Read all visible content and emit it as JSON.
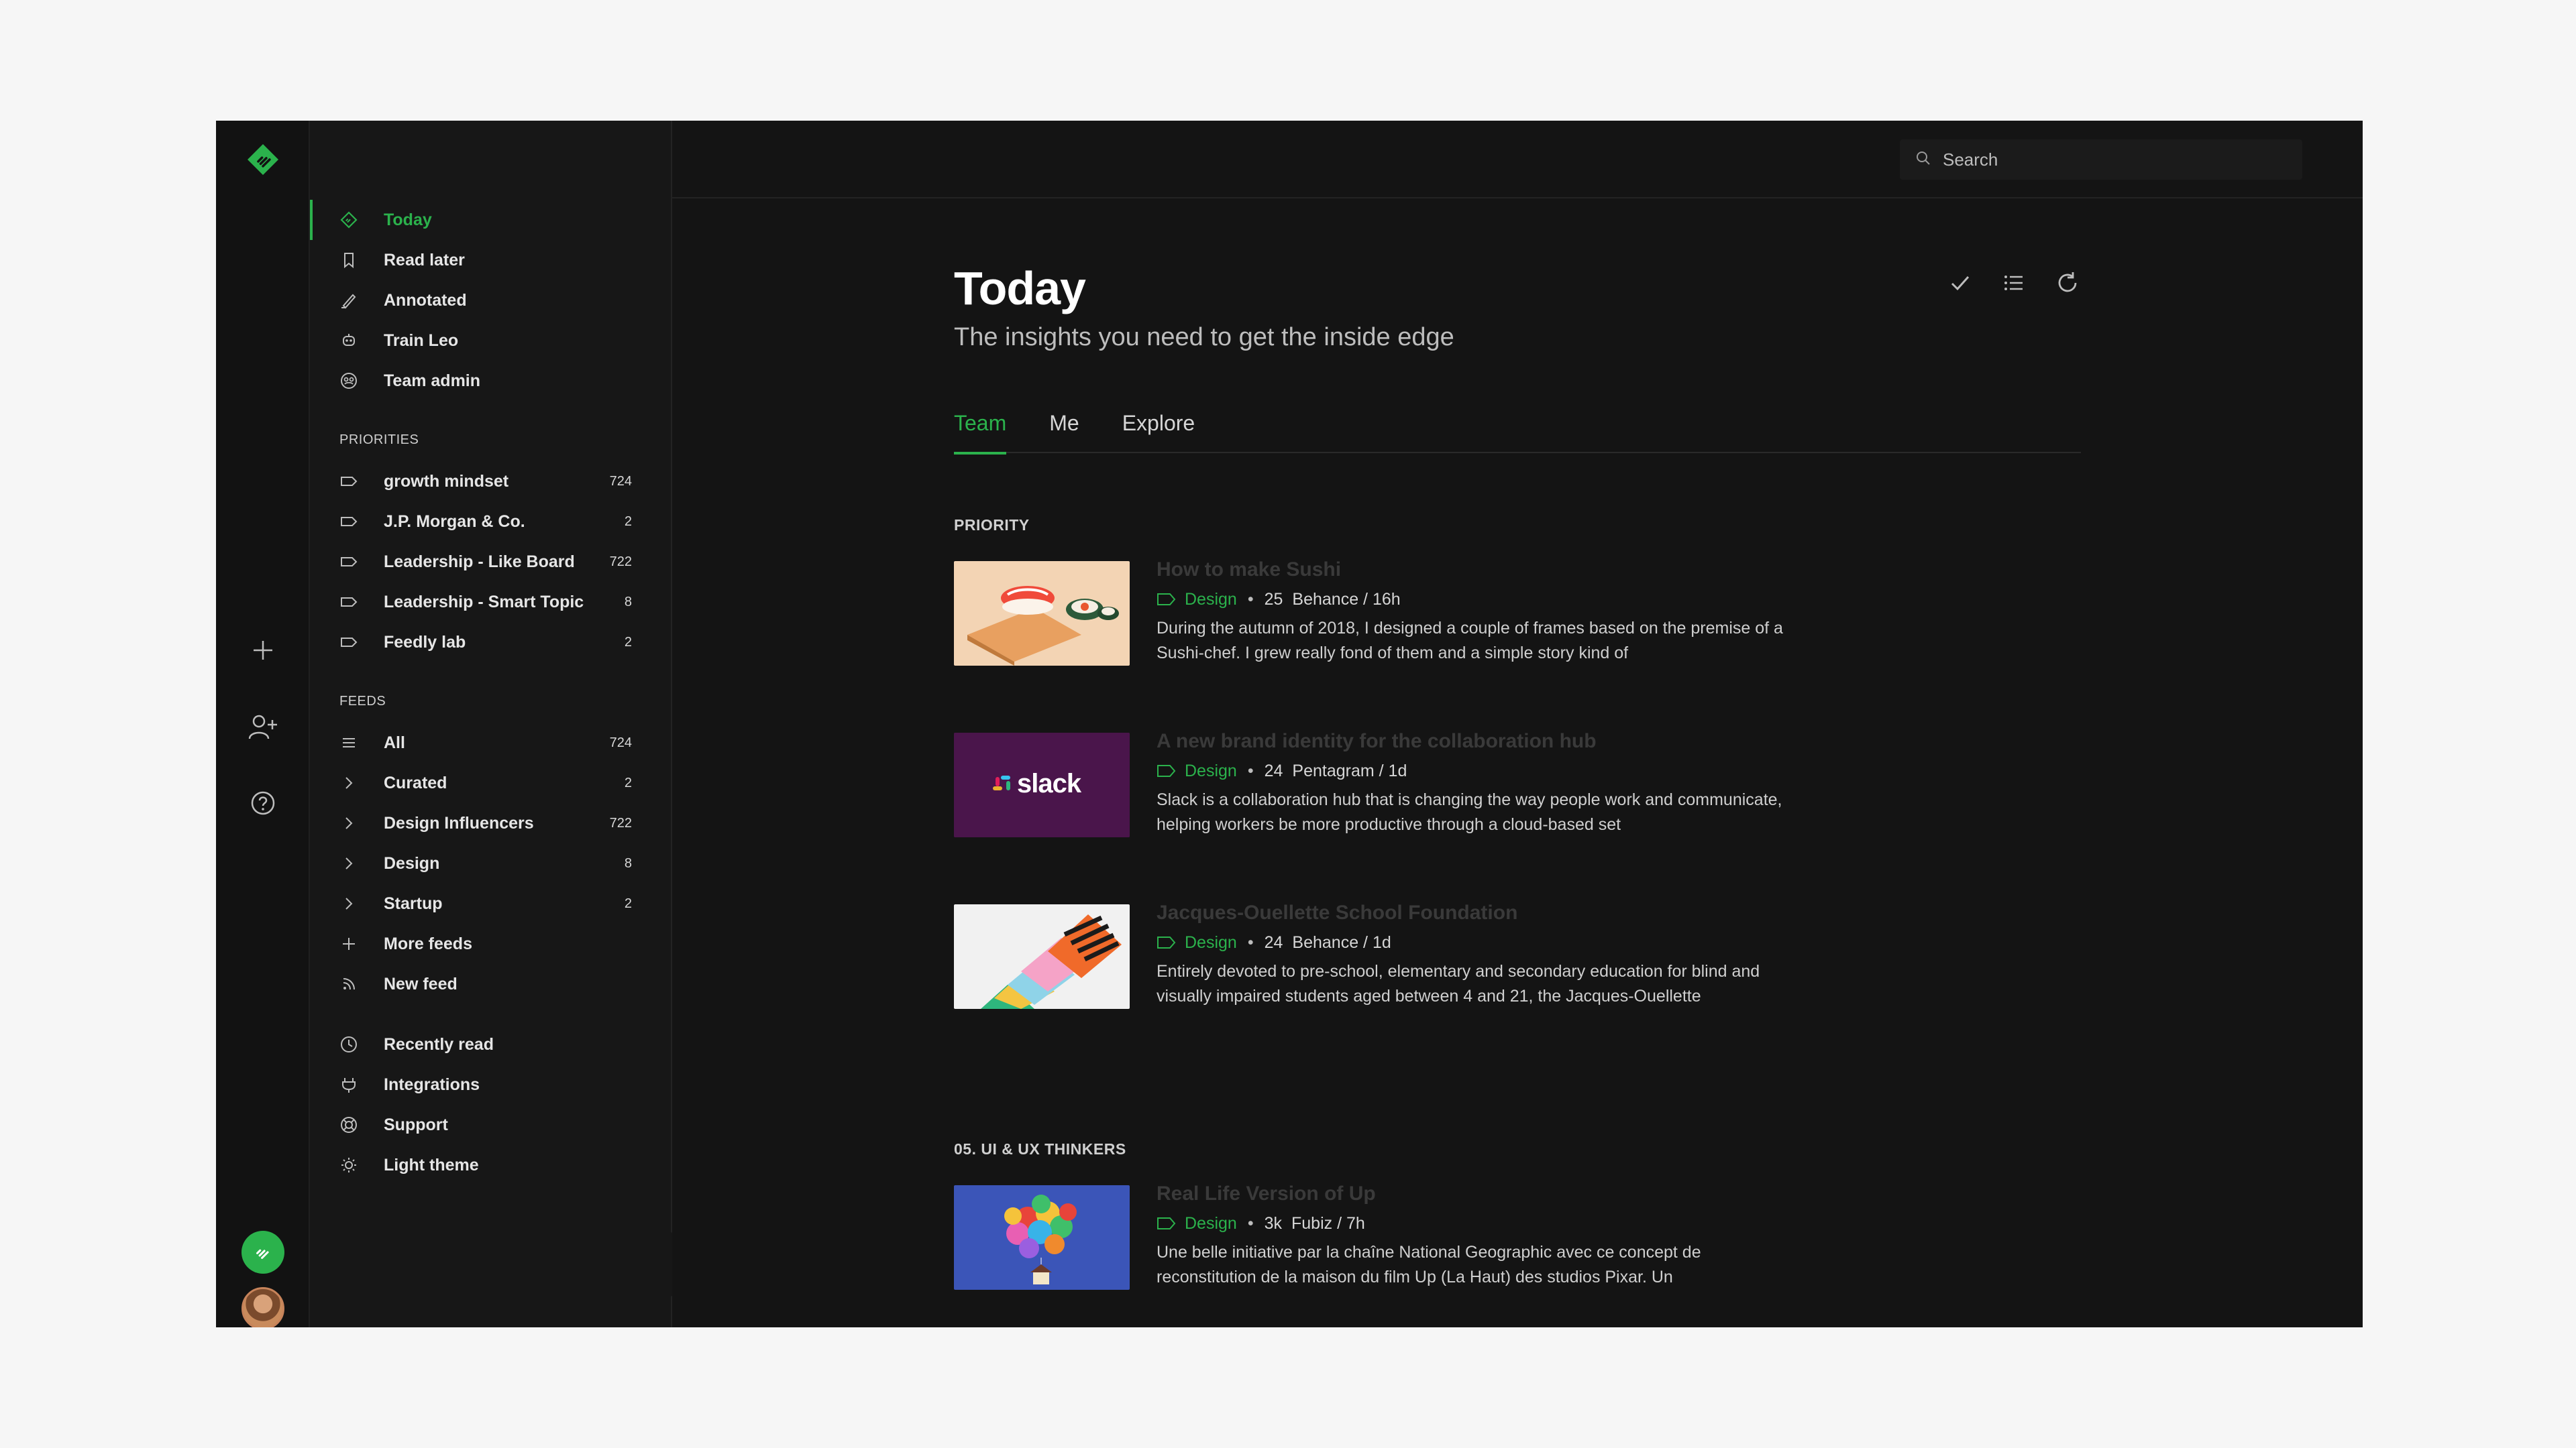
{
  "colors": {
    "accent": "#2bb24c",
    "background": "#141414",
    "sidebar": "#171717"
  },
  "search": {
    "placeholder": "Search"
  },
  "nav": {
    "top": [
      {
        "label": "Today",
        "icon": "feedly-diamond-icon",
        "active": true
      },
      {
        "label": "Read later",
        "icon": "bookmark-icon"
      },
      {
        "label": "Annotated",
        "icon": "pen-icon"
      },
      {
        "label": "Train Leo",
        "icon": "leo-robot-icon"
      },
      {
        "label": "Team admin",
        "icon": "team-icon"
      }
    ],
    "priorities_title": "PRIORITIES",
    "priorities": [
      {
        "label": "growth mindset",
        "count": "724"
      },
      {
        "label": "J.P. Morgan & Co.",
        "count": "2"
      },
      {
        "label": "Leadership - Like Board",
        "count": "722"
      },
      {
        "label": "Leadership - Smart Topic",
        "count": "8"
      },
      {
        "label": "Feedly lab",
        "count": "2"
      }
    ],
    "feeds_title": "FEEDS",
    "feeds": [
      {
        "label": "All",
        "count": "724"
      },
      {
        "label": "Curated",
        "count": "2"
      },
      {
        "label": "Design Influencers",
        "count": "722"
      },
      {
        "label": "Design",
        "count": "8"
      },
      {
        "label": "Startup",
        "count": "2"
      }
    ],
    "more_feeds": "More feeds",
    "new_feed": "New feed",
    "bottom": [
      {
        "label": "Recently read",
        "icon": "clock-icon"
      },
      {
        "label": "Integrations",
        "icon": "plug-icon"
      },
      {
        "label": "Support",
        "icon": "lifebuoy-icon"
      },
      {
        "label": "Light theme",
        "icon": "sun-icon"
      }
    ]
  },
  "main": {
    "title": "Today",
    "subtitle": "The insights you need to get the inside edge",
    "tabs": [
      {
        "label": "Team",
        "active": true
      },
      {
        "label": "Me"
      },
      {
        "label": "Explore"
      }
    ],
    "groups": [
      {
        "title": "PRIORITY",
        "articles": [
          {
            "title": "How to make Sushi",
            "tag": "Design",
            "count": "25",
            "source": "Behance / 16h",
            "summary": "During the autumn of 2018, I designed a couple of frames based on the premise of a Sushi-chef. I grew really fond of them and a simple story kind of"
          },
          {
            "title": "A new brand identity for the collaboration hub",
            "tag": "Design",
            "count": "24",
            "source": "Pentagram / 1d",
            "summary": "Slack is a collaboration hub that is changing the way people work and communicate, helping workers be more productive through a cloud-based set",
            "thumb_text": "slack"
          },
          {
            "title": "Jacques-Ouellette School Foundation",
            "tag": "Design",
            "count": "24",
            "source": "Behance / 1d",
            "summary": "Entirely devoted to pre-school, elementary and secondary education for blind and visually impaired students aged between 4 and 21, the Jacques-Ouellette"
          }
        ]
      },
      {
        "title": "05. UI & UX THINKERS",
        "articles": [
          {
            "title": "Real Life Version of Up",
            "tag": "Design",
            "count": "3k",
            "source": "Fubiz / 7h",
            "summary": "Une belle initiative par la chaîne National Geographic avec ce concept de reconstitution de la maison du film Up (La Haut) des studios Pixar. Un"
          }
        ]
      }
    ]
  }
}
